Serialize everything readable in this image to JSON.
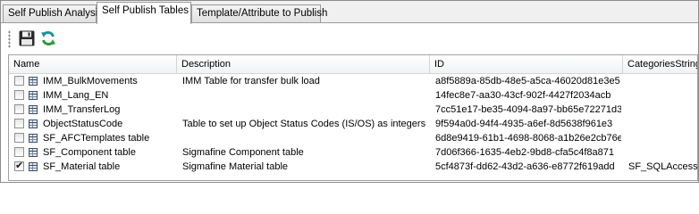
{
  "tabs": [
    {
      "label": "Self Publish Analysis",
      "active": false
    },
    {
      "label": "Self Publish Tables",
      "active": true
    },
    {
      "label": "Template/Attribute to Publish",
      "active": false
    }
  ],
  "toolbar": {
    "save_icon": "save-icon",
    "refresh_icon": "refresh-icon"
  },
  "table": {
    "columns": [
      "Name",
      "Description",
      "ID",
      "CategoriesString"
    ],
    "rows": [
      {
        "checked": false,
        "name": "IMM_BulkMovements",
        "description": "IMM Table for transfer bulk load",
        "id": "a8f5889a-85db-48e5-a5ca-46020d81e3e5",
        "categories": ""
      },
      {
        "checked": false,
        "name": "IMM_Lang_EN",
        "description": "",
        "id": "14fec8e7-aa30-43cf-902f-4427f2034acb",
        "categories": ""
      },
      {
        "checked": false,
        "name": "IMM_TransferLog",
        "description": "",
        "id": "7cc51e17-be35-4094-8a97-bb65e72271d3",
        "categories": ""
      },
      {
        "checked": false,
        "name": "ObjectStatusCode",
        "description": "Table to set up Object Status  Codes (IS/OS) as integers",
        "id": "9f594a0d-94f4-4935-a6ef-8d5638f961e3",
        "categories": ""
      },
      {
        "checked": false,
        "name": "SF_AFCTemplates table",
        "description": "",
        "id": "6d8e9419-61b1-4698-8068-a1b26e2cb76e",
        "categories": ""
      },
      {
        "checked": false,
        "name": "SF_Component table",
        "description": "Sigmafine Component table",
        "id": "7d06f366-1635-4eb2-9bd8-cfa5c4f8a871",
        "categories": ""
      },
      {
        "checked": true,
        "name": "SF_Material table",
        "description": "Sigmafine Material table",
        "id": "5cf4873f-dd62-43d2-a636-e8772f619add",
        "categories": "SF_SQLAccess;"
      }
    ]
  }
}
